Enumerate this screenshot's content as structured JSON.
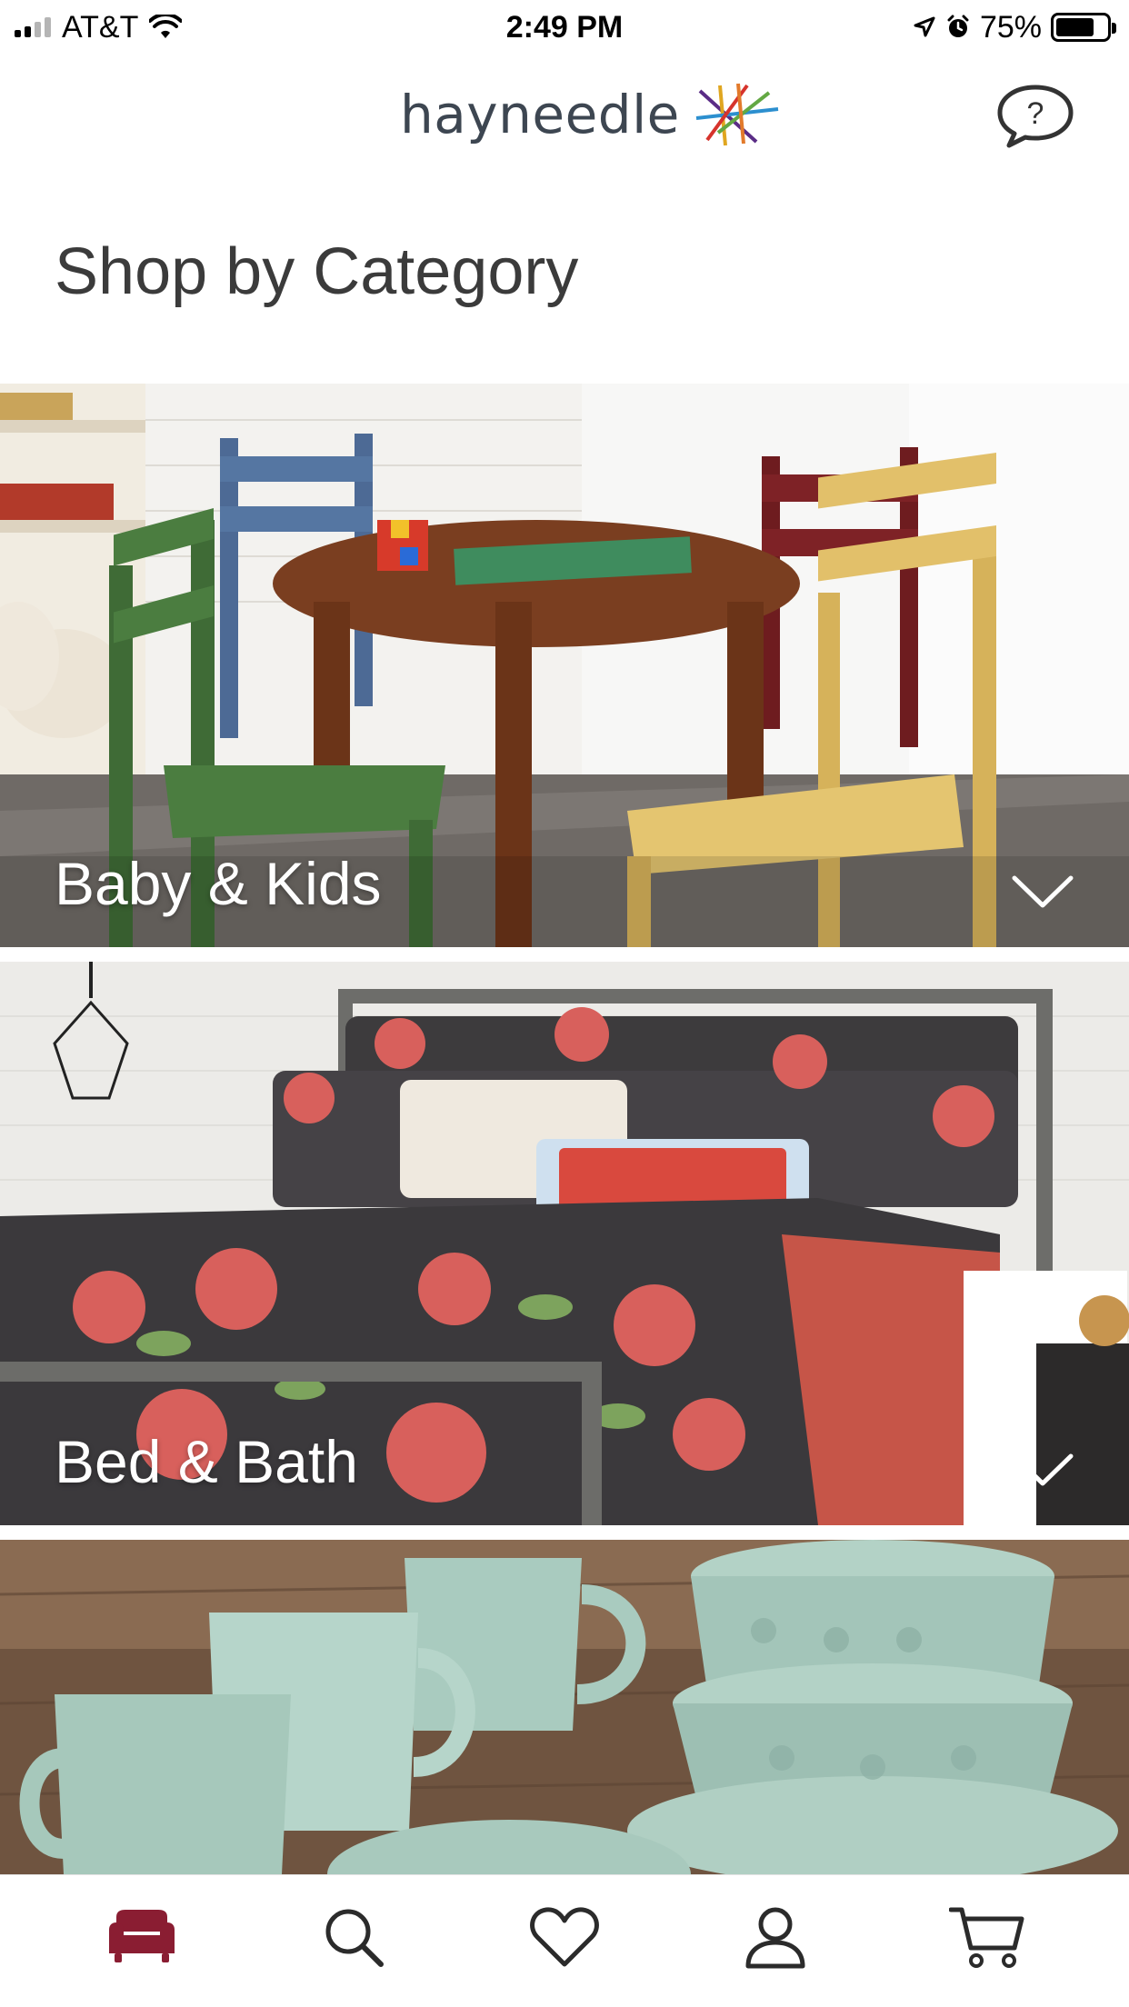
{
  "status_bar": {
    "carrier": "AT&T",
    "time": "2:49 PM",
    "battery_percent": "75%",
    "battery_level": 0.75
  },
  "header": {
    "logo_text": "hayneedle",
    "help_icon": "chat-question-icon"
  },
  "page": {
    "title": "Shop by Category"
  },
  "categories": [
    {
      "label": "Baby & Kids",
      "icon": "chevron-down-icon"
    },
    {
      "label": "Bed & Bath",
      "icon": "chevron-down-icon"
    },
    {
      "label": "",
      "icon": ""
    }
  ],
  "tab_bar": {
    "tabs": [
      {
        "icon": "sofa-icon",
        "active": true
      },
      {
        "icon": "search-icon",
        "active": false
      },
      {
        "icon": "heart-icon",
        "active": false
      },
      {
        "icon": "user-icon",
        "active": false
      },
      {
        "icon": "cart-icon",
        "active": false
      }
    ]
  },
  "colors": {
    "active_tab": "#8a1d32",
    "inactive_tab": "#2b2b2b",
    "title_text": "#3b3b3b",
    "logo_text": "#3d4651"
  }
}
